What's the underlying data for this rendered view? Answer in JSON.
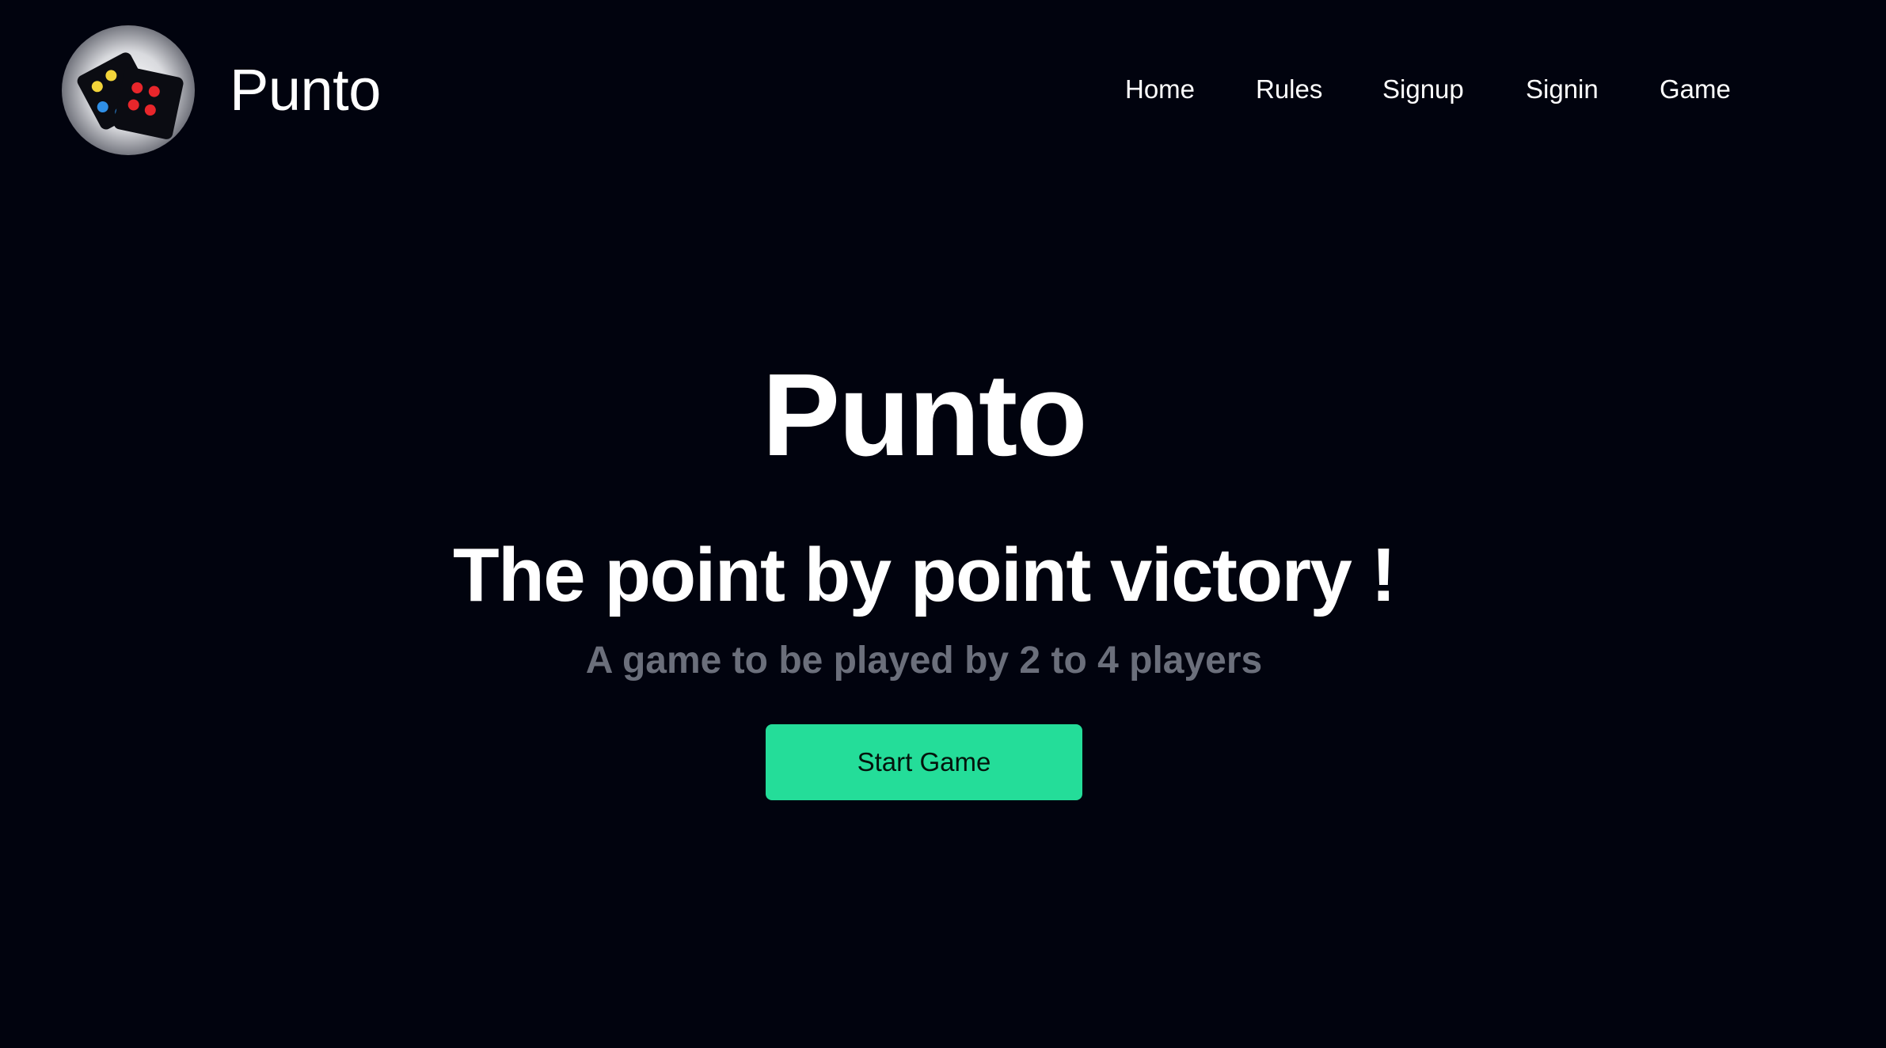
{
  "header": {
    "brand": "Punto",
    "logo_icon": "punto-cards-logo",
    "nav": [
      {
        "label": "Home"
      },
      {
        "label": "Rules"
      },
      {
        "label": "Signup"
      },
      {
        "label": "Signin"
      },
      {
        "label": "Game"
      }
    ]
  },
  "hero": {
    "title": "Punto",
    "subtitle": "The point by point victory !",
    "tagline": "A game to be played by 2 to 4 players",
    "start_label": "Start Game"
  },
  "colors": {
    "background": "#01030e",
    "accent": "#24dd99",
    "muted_text": "#6b6f7b",
    "text": "#ffffff"
  }
}
